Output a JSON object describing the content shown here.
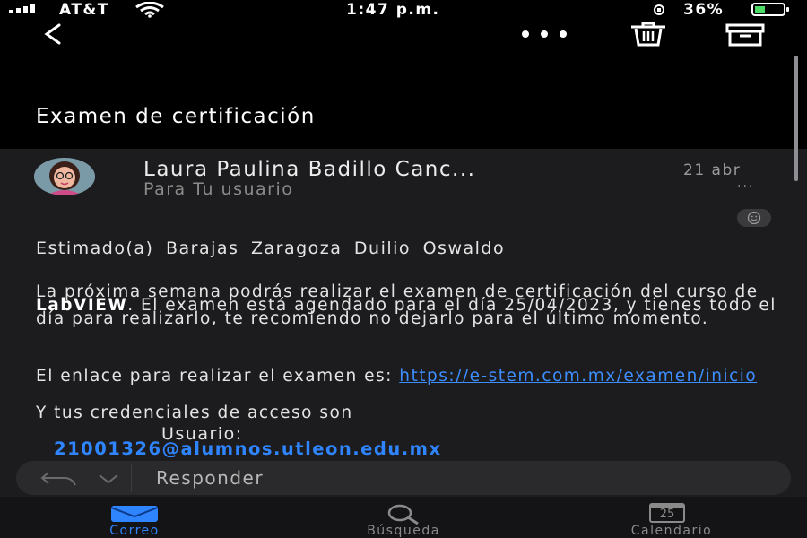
{
  "status_bar": {
    "carrier": "AT&T",
    "time": "1:47 p.m.",
    "battery": "36%",
    "battery_level": 0.36
  },
  "email": {
    "subject": "Examen de certificación",
    "sender": "Laura Paulina Badillo Canc...",
    "date": "21 abr",
    "recipient": "Para Tu usuario",
    "more": "···",
    "greeting": "Estimado(a)  Barajas Zaragoza Duilio Oswaldo",
    "para_1a": "La próxima semana podrás realizar el examen de certificación del curso de ",
    "para_1_bold": "LabVIEW",
    "para_1b": ". El examen está agendado para el día 25/04/2023,  y tienes todo el día para realizarlo, te recomiendo no dejarlo para el último momento.",
    "link_intro": "El enlace para realizar el examen es:  ",
    "link": "https://e-stem.com.mx/examen/inicio",
    "credentials_intro": "Y tus credenciales de acceso son",
    "user_label": "Usuario:",
    "user_email": "21001326@alumnos.utleon.edu.mx"
  },
  "reply": {
    "label": "Responder"
  },
  "tabs": [
    {
      "label": "Correo",
      "active": true
    },
    {
      "label": "Búsqueda",
      "active": false
    },
    {
      "label": "Calendario",
      "active": false,
      "day": "25"
    }
  ],
  "colors": {
    "accent": "#2f84ff",
    "background": "#1c1c1e",
    "header": "#000000"
  }
}
